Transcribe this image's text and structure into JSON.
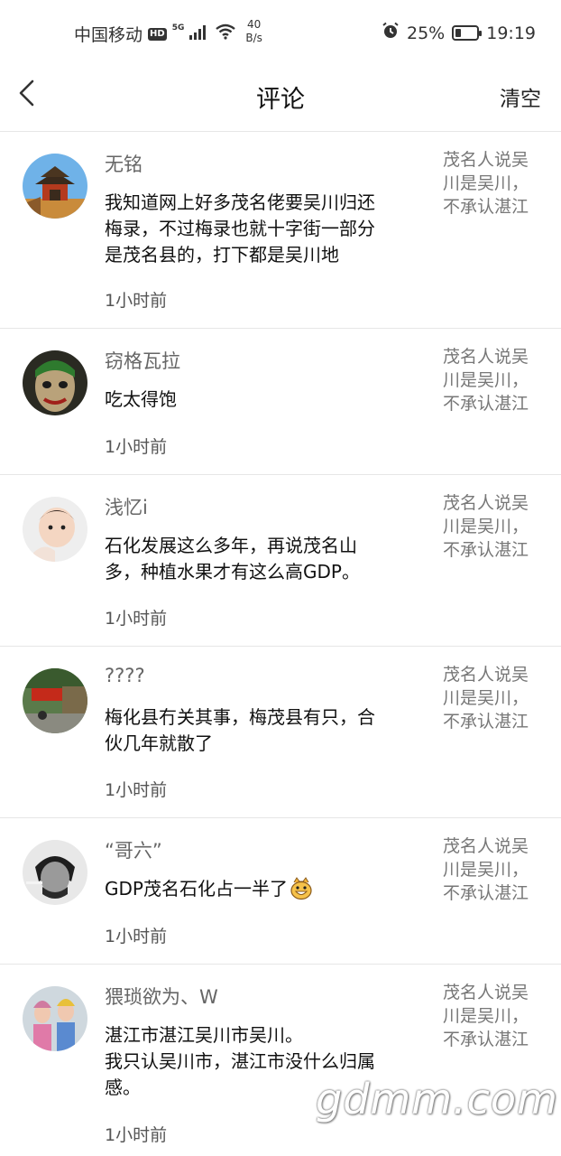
{
  "status_bar": {
    "carrier": "中国移动",
    "hd_badge": "HD",
    "network": "5G",
    "speed_value": "40",
    "speed_unit": "B/s",
    "battery_percent": "25%",
    "battery_level": 0.25,
    "time": "19:19",
    "icons": [
      "signal-bars-icon",
      "wifi-icon",
      "alarm-icon",
      "battery-icon"
    ]
  },
  "header": {
    "title": "评论",
    "clear_label": "清空",
    "back_icon": "chevron-left-icon"
  },
  "comments": [
    {
      "name": "无铭",
      "text": "我知道网上好多茂名佬要吴川归还\n梅录，不过梅录也就十字街一部分\n是茂名县的，打下都是吴川地",
      "time": "1小时前",
      "ref": "茂名人说吴川是吴川，不承认湛江"
    },
    {
      "name": "窃格瓦拉",
      "text": "吃太得饱",
      "time": "1小时前",
      "ref": "茂名人说吴川是吴川，不承认湛江"
    },
    {
      "name": "浅忆i",
      "text": "石化发展这么多年，再说茂名山\n多，种植水果才有这么高GDP。",
      "time": "1小时前",
      "ref": "茂名人说吴川是吴川，不承认湛江"
    },
    {
      "name": "????",
      "text": "梅化县冇关其事，梅茂县有只，合\n伙几年就散了",
      "time": "1小时前",
      "ref": "茂名人说吴川是吴川，不承认湛江"
    },
    {
      "name": "“哥六”",
      "text": "GDP茂名石化占一半了",
      "time": "1小时前",
      "ref": "茂名人说吴川是吴川，不承认湛江"
    },
    {
      "name": "猥琐欲为、W",
      "text": "湛江市湛江吴川市吴川。\n我只认吴川市，湛江市没什么归属\n感。",
      "time": "1小时前",
      "ref": "茂名人说吴川是吴川，不承认湛江"
    }
  ],
  "watermark": "gdmm.com"
}
